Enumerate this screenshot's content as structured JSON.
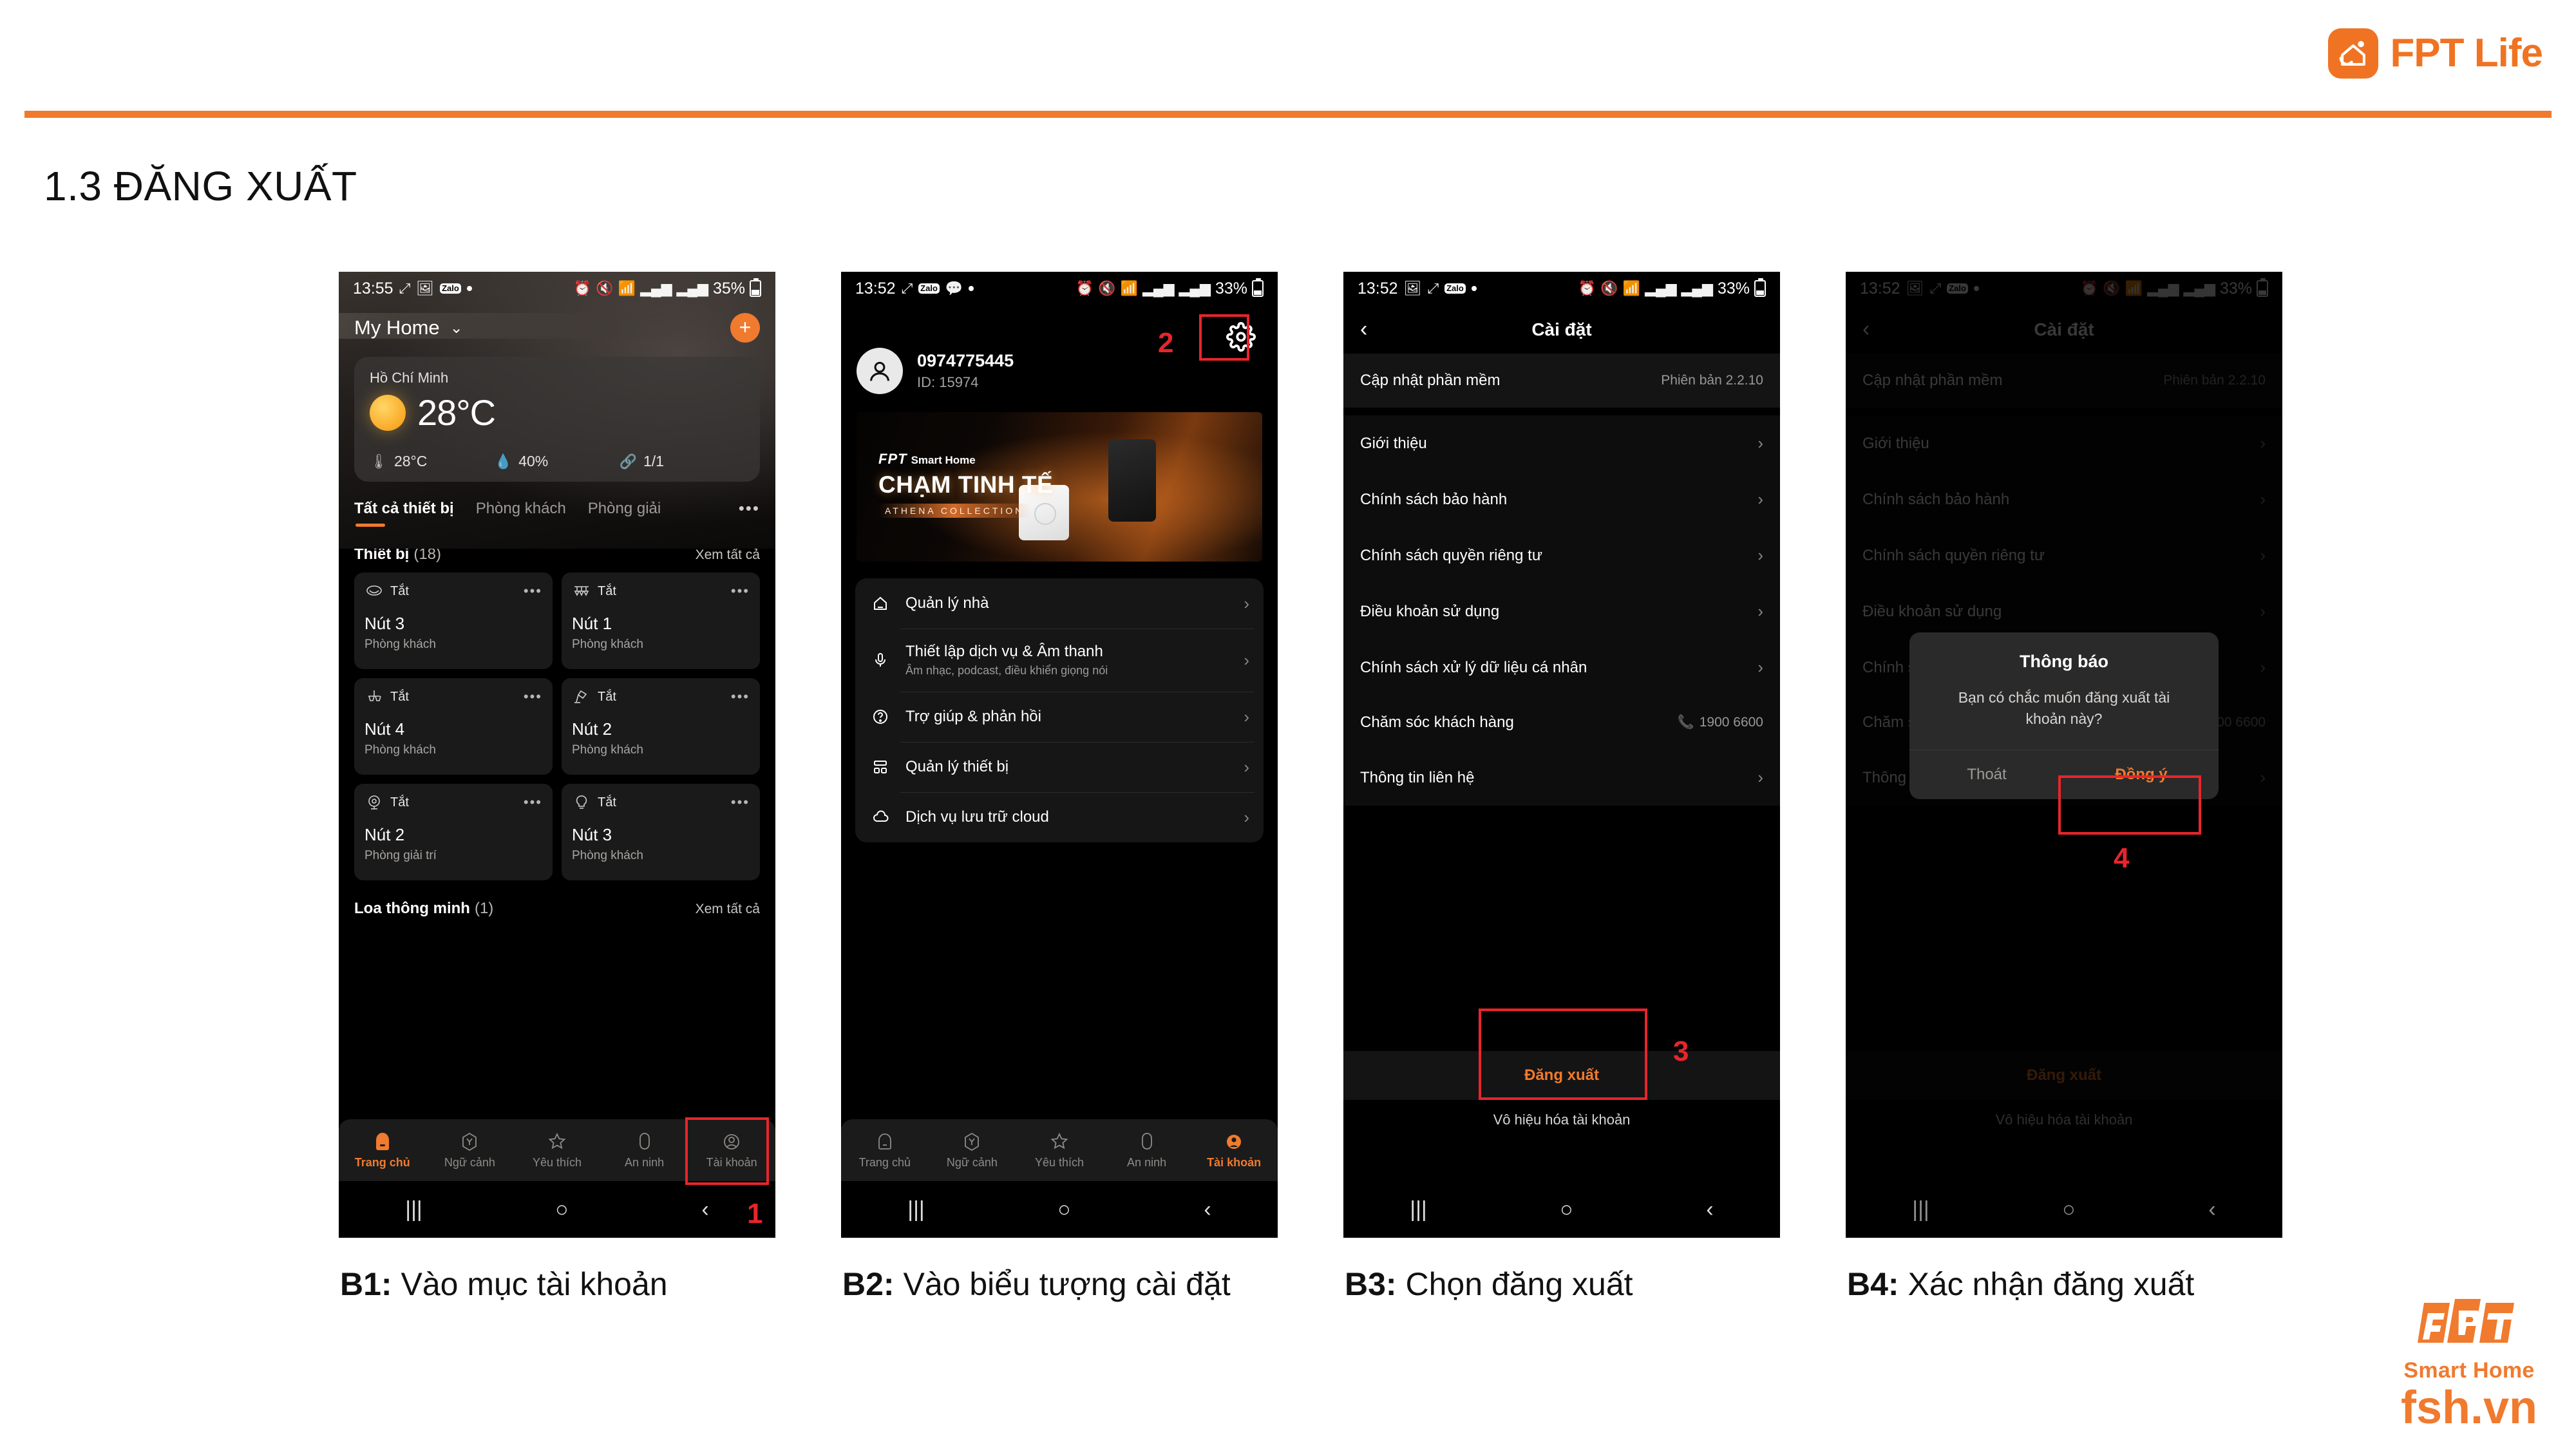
{
  "header": {
    "brand": "FPT Life",
    "brand_icon": "fpt-life-house-icon",
    "accent": "#F07A2E"
  },
  "page_title": "1.3 ĐĂNG XUẤT",
  "phone1": {
    "status": {
      "time": "13:55",
      "battery": "35%",
      "icons": [
        "share-icon",
        "photo-icon",
        "zalo-icon",
        "dot-icon",
        "alarm-icon",
        "mute-icon",
        "wifi-icon",
        "signal-icon",
        "signal2-icon",
        "battery-charging-icon"
      ]
    },
    "home_title": "My Home",
    "add_label": "+",
    "weather": {
      "city": "Hồ Chí Minh",
      "temp": "28°C",
      "feels": "28°C",
      "humidity": "40%",
      "devices": "1/1"
    },
    "tabs": [
      "Tất cả thiết bị",
      "Phòng khách",
      "Phòng giải"
    ],
    "tabs_more": "•••",
    "section": {
      "title": "Thiết bị",
      "count": "(18)",
      "see_all": "Xem tất cả"
    },
    "devices": [
      {
        "icon": "ceiling-fan-icon",
        "state": "Tắt",
        "name": "Nút 3",
        "room": "Phòng khách"
      },
      {
        "icon": "pendant-lights-icon",
        "state": "Tắt",
        "name": "Nút 1",
        "room": "Phòng khách"
      },
      {
        "icon": "wall-lamp-icon",
        "state": "Tắt",
        "name": "Nút 4",
        "room": "Phòng khách"
      },
      {
        "icon": "desk-lamp-icon",
        "state": "Tắt",
        "name": "Nút 2",
        "room": "Phòng khách"
      },
      {
        "icon": "spotlight-icon",
        "state": "Tắt",
        "name": "Nút 2",
        "room": "Phòng giải trí"
      },
      {
        "icon": "bulb-icon",
        "state": "Tắt",
        "name": "Nút 3",
        "room": "Phòng khách"
      }
    ],
    "section2": {
      "title": "Loa thông minh",
      "count": "(1)",
      "see_all": "Xem tất cả"
    },
    "nav": [
      {
        "label": "Trang chủ",
        "icon": "home-icon",
        "active": true
      },
      {
        "label": "Ngữ cảnh",
        "icon": "scene-icon",
        "active": false
      },
      {
        "label": "Yêu thích",
        "icon": "star-icon",
        "active": false
      },
      {
        "label": "An ninh",
        "icon": "shield-icon",
        "active": false
      },
      {
        "label": "Tài khoản",
        "icon": "account-icon",
        "active": false
      }
    ],
    "annotation": "1"
  },
  "phone2": {
    "status": {
      "time": "13:52",
      "battery": "33%"
    },
    "gear_icon": "gear-icon",
    "account": {
      "phone": "0974775445",
      "id": "ID: 15974",
      "avatar": "avatar-icon"
    },
    "banner": {
      "brand": "FPT",
      "brand_sub": "Smart Home",
      "headline": "CHẠM TINH TẾ",
      "collection": "ATHENA COLLECTION"
    },
    "menu": [
      {
        "icon": "home-outline-icon",
        "title": "Quản lý nhà",
        "sub": ""
      },
      {
        "icon": "microphone-icon",
        "title": "Thiết lập dịch vụ & Âm thanh",
        "sub": "Âm nhạc, podcast, điều khiển giọng nói"
      },
      {
        "icon": "question-circle-icon",
        "title": "Trợ giúp & phản hồi",
        "sub": ""
      },
      {
        "icon": "devices-grid-icon",
        "title": "Quản lý thiết bị",
        "sub": ""
      },
      {
        "icon": "cloud-icon",
        "title": "Dịch vụ lưu trữ cloud",
        "sub": ""
      }
    ],
    "nav": [
      {
        "label": "Trang chủ",
        "icon": "home-icon",
        "active": false
      },
      {
        "label": "Ngữ cảnh",
        "icon": "scene-icon",
        "active": false
      },
      {
        "label": "Yêu thích",
        "icon": "star-icon",
        "active": false
      },
      {
        "label": "An ninh",
        "icon": "shield-icon",
        "active": false
      },
      {
        "label": "Tài khoản",
        "icon": "account-icon",
        "active": true
      }
    ],
    "annotation": "2"
  },
  "phone3": {
    "status": {
      "time": "13:52",
      "battery": "33%"
    },
    "appbar": {
      "back": "‹",
      "title": "Cài đặt"
    },
    "items": [
      {
        "label": "Cập nhật phần mềm",
        "value": "Phiên bản 2.2.10",
        "chevron": false
      },
      {
        "label": "Giới thiệu",
        "value": "",
        "chevron": true
      },
      {
        "label": "Chính sách bảo hành",
        "value": "",
        "chevron": true
      },
      {
        "label": "Chính sách quyền riêng tư",
        "value": "",
        "chevron": true
      },
      {
        "label": "Điều khoản sử dụng",
        "value": "",
        "chevron": true
      },
      {
        "label": "Chính sách xử lý dữ liệu cá nhân",
        "value": "",
        "chevron": true
      },
      {
        "label": "Chăm sóc khách hàng",
        "value": "1900 6600",
        "chevron": false,
        "icon": "phone-icon"
      },
      {
        "label": "Thông tin liên hệ",
        "value": "",
        "chevron": true
      }
    ],
    "logout_label": "Đăng xuất",
    "disable_label": "Vô hiệu hóa tài khoản",
    "annotation": "3"
  },
  "phone4": {
    "status": {
      "time": "13:52",
      "battery": "33%"
    },
    "appbar": {
      "back": "‹",
      "title": "Cài đặt"
    },
    "dialog": {
      "title": "Thông báo",
      "message": "Bạn có chắc muốn đăng xuất tài khoản này?",
      "cancel": "Thoát",
      "confirm": "Đồng ý"
    },
    "annotation": "4"
  },
  "captions": {
    "b1_step": "B1:",
    "b1_text": " Vào mục tài khoản",
    "b2_step": "B2:",
    "b2_text": " Vào biểu tượng cài đặt",
    "b3_step": "B3:",
    "b3_text": " Chọn đăng xuất",
    "b4_step": "B4:",
    "b4_text": " Xác nhận đăng xuất"
  },
  "footer": {
    "brand": "FPT",
    "brand_sub": "Smart Home",
    "url": "fsh.vn"
  }
}
